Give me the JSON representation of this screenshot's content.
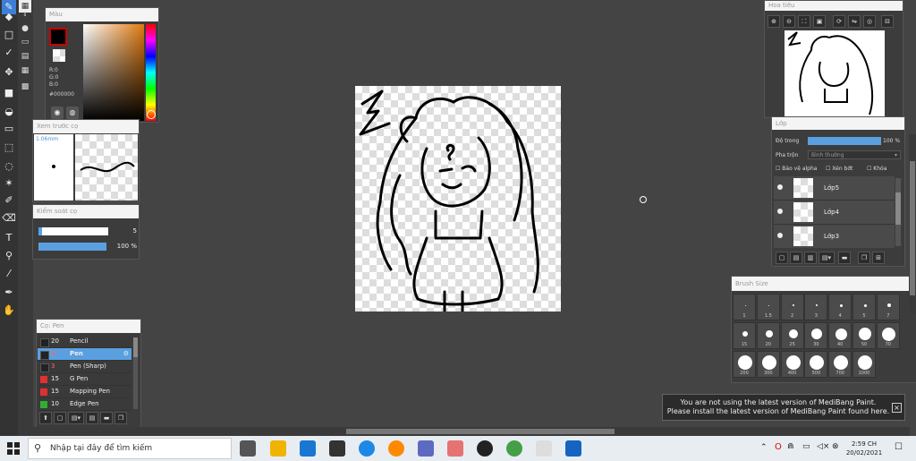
{
  "color_panel": {
    "title": "Màu",
    "r": "R:0",
    "g": "G:0",
    "b": "B:0",
    "hex": "#000000"
  },
  "brush_preview": {
    "title": "Xem trước cọ",
    "size": "1.06mm"
  },
  "brush_control": {
    "title": "Kiểm soát cọ",
    "size_value": "5",
    "opacity_value": "100 %"
  },
  "brush_list": {
    "title": "Cọ: Pen",
    "items": [
      {
        "num": "20",
        "name": "Pencil",
        "color": "#222222"
      },
      {
        "num": "5",
        "name": "Pen",
        "color": "#222222"
      },
      {
        "num": "3",
        "name": "Pen (Sharp)",
        "color": "#222222"
      },
      {
        "num": "15",
        "name": "G Pen",
        "color": "#e03030"
      },
      {
        "num": "15",
        "name": "Mapping Pen",
        "color": "#e03030"
      },
      {
        "num": "10",
        "name": "Edge Pen",
        "color": "#30b030"
      }
    ]
  },
  "navigator": {
    "title": "Hoa tiêu"
  },
  "layers": {
    "title": "Lớp",
    "opacity_label": "Độ trong",
    "opacity_value": "100 %",
    "blend_label": "Pha trộn",
    "blend_value": "Bình thường",
    "protect_alpha": "Bảo vệ alpha",
    "clipping": "Xén bớt",
    "lock": "Khóa",
    "items": [
      {
        "name": "Lớp5"
      },
      {
        "name": "Lớp4"
      },
      {
        "name": "Lớp3"
      }
    ]
  },
  "brush_size": {
    "title": "Brush Size",
    "rows": [
      [
        "1",
        "1.5",
        "2",
        "3",
        "4",
        "5",
        "7"
      ],
      [
        "15",
        "20",
        "25",
        "30",
        "40",
        "50",
        "70"
      ],
      [
        "200",
        "300",
        "400",
        "500",
        "700",
        "1000"
      ]
    ]
  },
  "notification": {
    "line1": "You are not using the latest version of MediBang Paint.",
    "line2": "Please install the latest version of MediBang Paint found here."
  },
  "taskbar": {
    "search_placeholder": "Nhập tại đây để tìm kiếm",
    "time": "2:59 CH",
    "date": "20/02/2021"
  },
  "colors": {
    "accent": "#5aa0e0",
    "window_bg": "#444444",
    "panel_bg": "#3c3c3c"
  }
}
